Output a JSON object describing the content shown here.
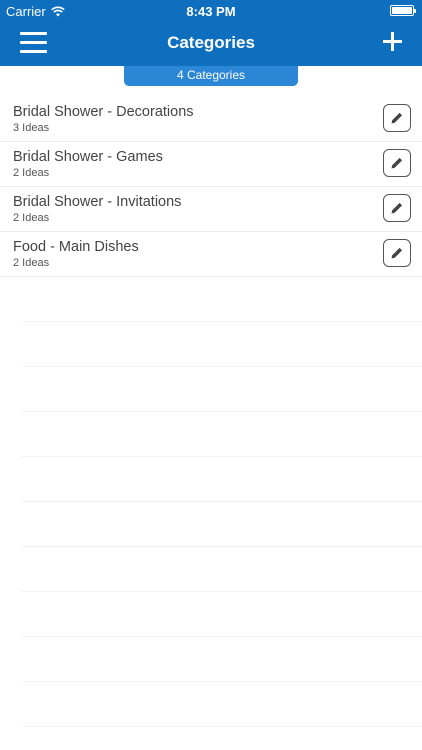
{
  "status_bar": {
    "carrier": "Carrier",
    "time": "8:43 PM"
  },
  "nav": {
    "title": "Categories",
    "menu_icon": "hamburger-menu-icon",
    "add_icon": "plus-icon"
  },
  "badge": {
    "count_label": "4 Categories"
  },
  "categories": [
    {
      "title": "Bridal Shower - Decorations",
      "subtitle": "3 Ideas"
    },
    {
      "title": "Bridal Shower - Games",
      "subtitle": "2 Ideas"
    },
    {
      "title": "Bridal Shower - Invitations",
      "subtitle": "2 Ideas"
    },
    {
      "title": "Food - Main Dishes",
      "subtitle": "2 Ideas"
    }
  ],
  "colors": {
    "header": "#0f6fbf",
    "badge": "#2b86d6"
  }
}
